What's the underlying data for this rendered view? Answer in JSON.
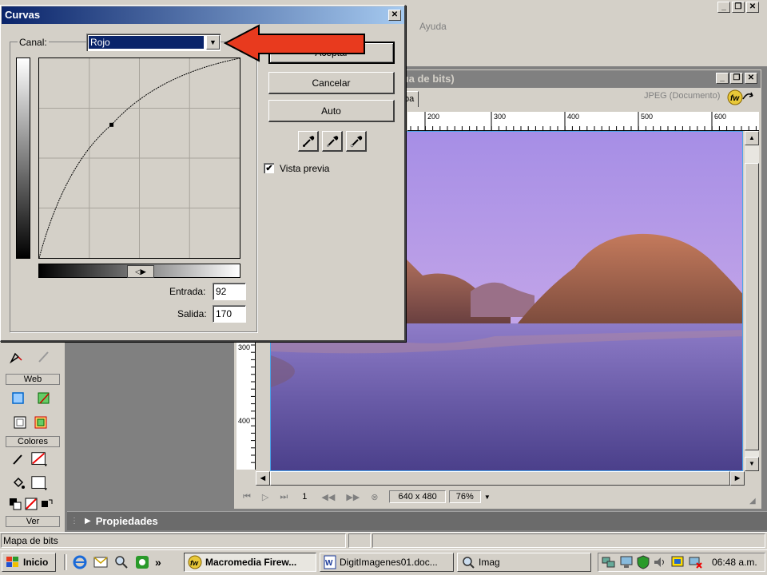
{
  "app": {
    "menu_visible": "Ayuda",
    "window_controls": {
      "minimize": "_",
      "maximize": "❐",
      "close": "✕"
    }
  },
  "tools": {
    "sections": [
      "Web",
      "Colores",
      "Ver"
    ]
  },
  "document": {
    "title_partial": "ıa de bits)",
    "tab_partial": "ba",
    "format_label": "JPEG (Documento)",
    "ruler_top": [
      "200",
      "300",
      "400",
      "500",
      "600"
    ],
    "ruler_left": [
      "300",
      "400"
    ],
    "status": {
      "frame": "1",
      "size": "640 x 480",
      "zoom": "76%"
    }
  },
  "properties_panel": {
    "label": "Propiedades"
  },
  "status_bar": {
    "text": "Mapa de bits"
  },
  "dialog": {
    "title": "Curvas",
    "channel_label": "Canal:",
    "channel_value": "Rojo",
    "buttons": {
      "ok": "Aceptar",
      "cancel": "Cancelar",
      "auto": "Auto"
    },
    "preview_label": "Vista previa",
    "preview_checked": true,
    "input_label": "Entrada:",
    "input_value": "92",
    "output_label": "Salida:",
    "output_value": "170",
    "curve_point": {
      "input": 92,
      "output": 170
    },
    "arrow_color": "#e83a1e"
  },
  "taskbar": {
    "start": "Inicio",
    "chevron": "»",
    "items": [
      {
        "label": "Macromedia Firew...",
        "active": true
      },
      {
        "label": "DigitImagenes01.doc...",
        "active": false
      },
      {
        "label": "Imag",
        "active": false
      }
    ],
    "clock": "06:48 a.m."
  }
}
